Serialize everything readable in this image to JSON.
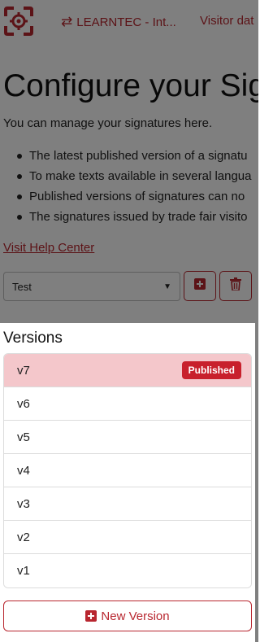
{
  "header": {
    "event_label": "LEARNTEC - Int...",
    "visitor_label": "Visitor dat"
  },
  "page": {
    "title": "Configure your Sig",
    "intro": "You can manage your signatures here.",
    "bullets": [
      "The latest published version of a signatu",
      "To make texts available in several langua",
      "Published versions of signatures can no",
      "The signatures issued by trade fair visito"
    ],
    "help_link": "Visit Help Center",
    "select_value": "Test"
  },
  "versions_panel": {
    "title": "Versions",
    "items": [
      {
        "label": "v7",
        "badge": "Published"
      },
      {
        "label": "v6"
      },
      {
        "label": "v5"
      },
      {
        "label": "v4"
      },
      {
        "label": "v3"
      },
      {
        "label": "v2"
      },
      {
        "label": "v1"
      }
    ],
    "new_version_label": "New Version"
  },
  "colors": {
    "brand": "#b8262f",
    "active_row": "#f4c7cb",
    "badge": "#c8202c"
  },
  "icons": [
    "logo-icon",
    "swap-icon",
    "plus-square-icon",
    "trash-icon",
    "chevron-down-icon"
  ]
}
